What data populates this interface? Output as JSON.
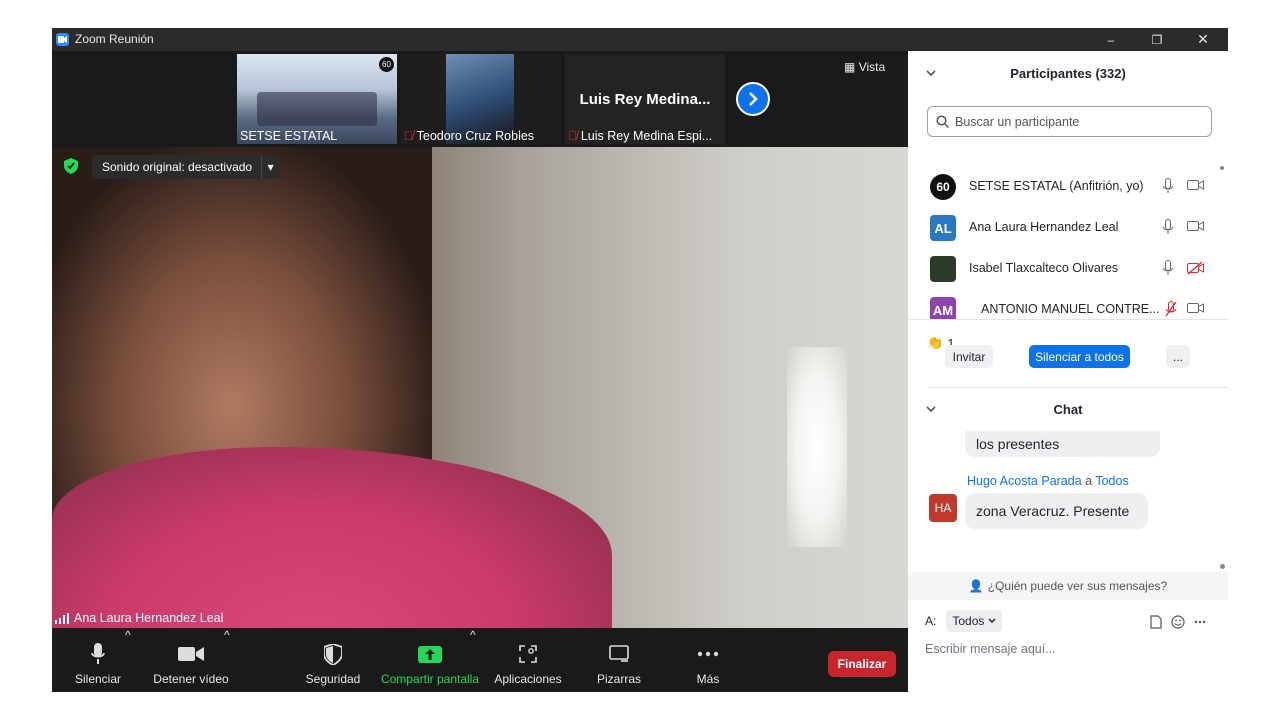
{
  "window": {
    "title": "Zoom Reunión",
    "minimize": "–",
    "restore": "❐",
    "close": "✕"
  },
  "strip": {
    "thumbs": [
      {
        "name": "SETSE ESTATAL"
      },
      {
        "name": "Teodoro Cruz Robles"
      },
      {
        "name": "Luis Rey Medina Espi...",
        "display": "Luis Rey Medina..."
      }
    ],
    "view_label": "Vista"
  },
  "video": {
    "sound_label": "Sonido original: desactivado",
    "speaker": "Ana Laura Hernandez Leal"
  },
  "toolbar": {
    "mute": "Silenciar",
    "stop_video": "Detener vídeo",
    "security": "Seguridad",
    "share": "Compartir pantalla",
    "apps": "Aplicaciones",
    "whiteboards": "Pizarras",
    "more": "Más",
    "end": "Finalizar"
  },
  "participants": {
    "title": "Participantes (332)",
    "search_placeholder": "Buscar un participante",
    "list": [
      {
        "avatar": "60",
        "name": "SETSE ESTATAL (Anfitrión, yo)",
        "color": "#111111"
      },
      {
        "avatar": "AL",
        "name": "Ana Laura Hernandez Leal",
        "color": "#2a78c2"
      },
      {
        "avatar": "",
        "name": "Isabel Tlaxcalteco Olivares",
        "color": "#2b3a2b"
      },
      {
        "avatar": "AM",
        "name": "ANTONIO MANUEL CONTRE...",
        "color": "#8e44ad"
      }
    ],
    "reactions_count": "1",
    "invite": "Invitar",
    "mute_all": "Silenciar a todos",
    "more": "..."
  },
  "chat": {
    "title": "Chat",
    "prev_bubble": "los presentes",
    "sender": "Hugo Acosta Parada",
    "to_word": "a",
    "recipient": "Todos",
    "sender_initials": "HA",
    "message": "zona Veracruz.  Presente",
    "who_can_see": "¿Quién puede ver sus mensajes?",
    "to_label": "A:",
    "to_value": "Todos",
    "input_placeholder": "Escribir mensaje aquí..."
  }
}
